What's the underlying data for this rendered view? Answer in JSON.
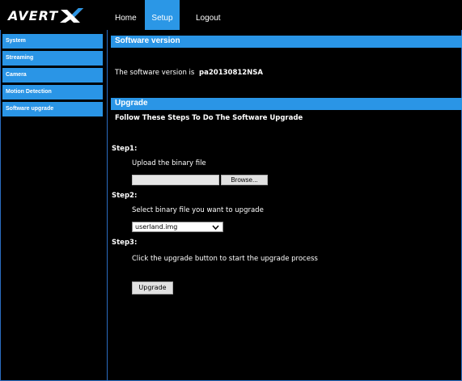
{
  "brand": {
    "logo_text": "AVERT",
    "logo_mark": "X"
  },
  "topnav": {
    "home": "Home",
    "setup": "Setup",
    "logout": "Logout"
  },
  "sidebar": {
    "items": [
      {
        "label": "System"
      },
      {
        "label": "Streaming"
      },
      {
        "label": "Camera"
      },
      {
        "label": "Motion Detection"
      },
      {
        "label": "Software upgrade"
      }
    ]
  },
  "software_version": {
    "header": "Software version",
    "label": "The software version is",
    "value": "pa20130812NSA"
  },
  "upgrade": {
    "header": "Upgrade",
    "intro": "Follow These Steps To Do The Software Upgrade",
    "step1": {
      "title": "Step1:",
      "desc": "Upload the binary file",
      "browse_label": "Browse..."
    },
    "step2": {
      "title": "Step2:",
      "desc": "Select binary file you want to upgrade",
      "selected": "userland.img"
    },
    "step3": {
      "title": "Step3:",
      "desc": "Click the upgrade button to start the upgrade process"
    },
    "button_label": "Upgrade"
  },
  "colors": {
    "accent": "#2a95e6",
    "background": "#000000",
    "border": "#2b6cc0"
  }
}
